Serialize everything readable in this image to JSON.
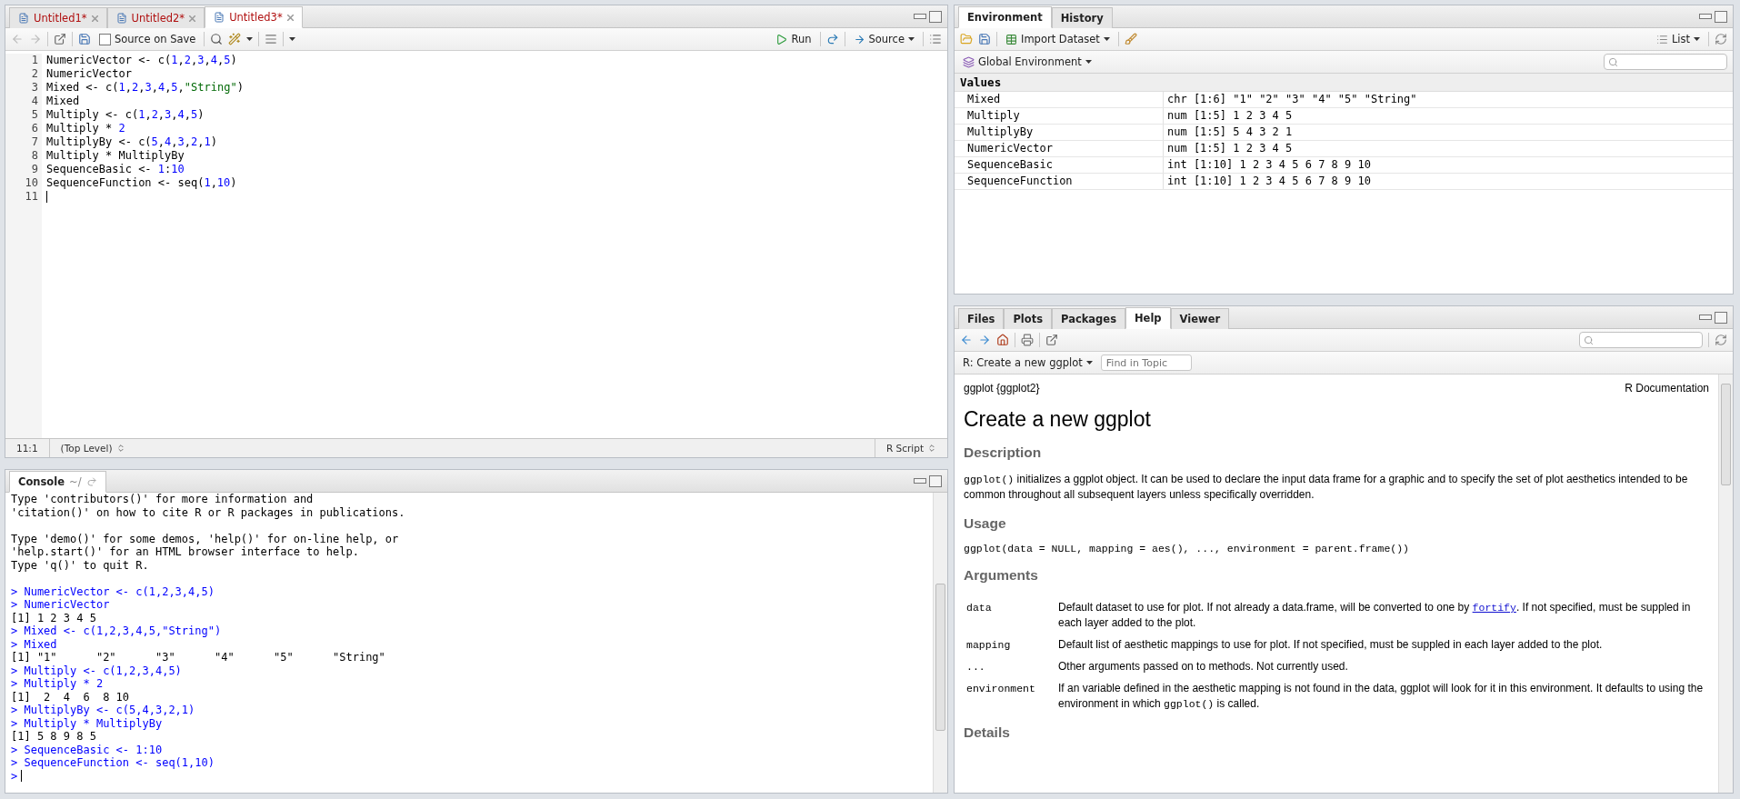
{
  "editor": {
    "tabs": [
      {
        "label": "Untitled1*",
        "selected": false
      },
      {
        "label": "Untitled2*",
        "selected": false
      },
      {
        "label": "Untitled3*",
        "selected": true
      }
    ],
    "toolbar": {
      "source_on_save": {
        "label": "Source on Save",
        "checked": false
      },
      "run": "Run",
      "source": "Source"
    },
    "lines": [
      {
        "n": "1",
        "code": "NumericVector <- c(1,2,3,4,5)"
      },
      {
        "n": "2",
        "code": "NumericVector"
      },
      {
        "n": "3",
        "code": "Mixed <- c(1,2,3,4,5,\"String\")"
      },
      {
        "n": "4",
        "code": "Mixed"
      },
      {
        "n": "5",
        "code": "Multiply <- c(1,2,3,4,5)"
      },
      {
        "n": "6",
        "code": "Multiply * 2"
      },
      {
        "n": "7",
        "code": "MultiplyBy <- c(5,4,3,2,1)"
      },
      {
        "n": "8",
        "code": "Multiply * MultiplyBy"
      },
      {
        "n": "9",
        "code": "SequenceBasic <- 1:10"
      },
      {
        "n": "10",
        "code": "SequenceFunction <- seq(1,10)"
      },
      {
        "n": "11",
        "cursor": true
      }
    ],
    "status": {
      "position": "11:1",
      "scope": "(Top Level)",
      "type": "R Script"
    }
  },
  "console": {
    "title": "Console",
    "path": "~/",
    "lines": [
      {
        "kind": "output",
        "text": "Type 'contributors()' for more information and"
      },
      {
        "kind": "output",
        "text": "'citation()' on how to cite R or R packages in publications."
      },
      {
        "kind": "blank"
      },
      {
        "kind": "output",
        "text": "Type 'demo()' for some demos, 'help()' for on-line help, or"
      },
      {
        "kind": "output",
        "text": "'help.start()' for an HTML browser interface to help."
      },
      {
        "kind": "output",
        "text": "Type 'q()' to quit R."
      },
      {
        "kind": "blank"
      },
      {
        "kind": "input",
        "text": "> NumericVector <- c(1,2,3,4,5)"
      },
      {
        "kind": "input",
        "text": "> NumericVector"
      },
      {
        "kind": "output",
        "text": "[1] 1 2 3 4 5"
      },
      {
        "kind": "input",
        "text": "> Mixed <- c(1,2,3,4,5,\"String\")"
      },
      {
        "kind": "input",
        "text": "> Mixed"
      },
      {
        "kind": "output",
        "text": "[1] \"1\"      \"2\"      \"3\"      \"4\"      \"5\"      \"String\""
      },
      {
        "kind": "input",
        "text": "> Multiply <- c(1,2,3,4,5)"
      },
      {
        "kind": "input",
        "text": "> Multiply * 2"
      },
      {
        "kind": "output",
        "text": "[1]  2  4  6  8 10"
      },
      {
        "kind": "input",
        "text": "> MultiplyBy <- c(5,4,3,2,1)"
      },
      {
        "kind": "input",
        "text": "> Multiply * MultiplyBy"
      },
      {
        "kind": "output",
        "text": "[1] 5 8 9 8 5"
      },
      {
        "kind": "input",
        "text": "> SequenceBasic <- 1:10"
      },
      {
        "kind": "input",
        "text": "> SequenceFunction <- seq(1,10)"
      },
      {
        "kind": "prompt",
        "text": ">"
      }
    ]
  },
  "environment": {
    "tabs": [
      {
        "label": "Environment",
        "selected": true
      },
      {
        "label": "History",
        "selected": false
      }
    ],
    "import": "Import Dataset",
    "view": "List",
    "scope": "Global Environment",
    "section": "Values",
    "rows": [
      {
        "name": "Mixed",
        "value": "chr [1:6] \"1\" \"2\" \"3\" \"4\" \"5\" \"String\""
      },
      {
        "name": "Multiply",
        "value": "num [1:5] 1 2 3 4 5"
      },
      {
        "name": "MultiplyBy",
        "value": "num [1:5] 5 4 3 2 1"
      },
      {
        "name": "NumericVector",
        "value": "num [1:5] 1 2 3 4 5"
      },
      {
        "name": "SequenceBasic",
        "value": "int [1:10] 1 2 3 4 5 6 7 8 9 10"
      },
      {
        "name": "SequenceFunction",
        "value": "int [1:10] 1 2 3 4 5 6 7 8 9 10"
      }
    ]
  },
  "help": {
    "tabs": [
      {
        "label": "Files",
        "selected": false
      },
      {
        "label": "Plots",
        "selected": false
      },
      {
        "label": "Packages",
        "selected": false
      },
      {
        "label": "Help",
        "selected": true
      },
      {
        "label": "Viewer",
        "selected": false
      }
    ],
    "topic": "R: Create a new ggplot",
    "find_placeholder": "Find in Topic",
    "page": {
      "name": "ggplot {ggplot2}",
      "doc": "R Documentation",
      "title": "Create a new ggplot",
      "sections": [
        {
          "kind": "heading",
          "text": "Description"
        },
        {
          "kind": "paragraph",
          "parts": [
            {
              "kind": "code",
              "text": "ggplot()"
            },
            {
              "kind": "text",
              "text": " initializes a ggplot object. It can be used to declare the input data frame for a graphic and to specify the set of plot aesthetics intended to be common throughout all subsequent layers unless specifically overridden."
            }
          ]
        },
        {
          "kind": "heading",
          "text": "Usage"
        },
        {
          "kind": "usage",
          "text": "ggplot(data = NULL, mapping = aes(), ..., environment = parent.frame())"
        },
        {
          "kind": "heading",
          "text": "Arguments"
        },
        {
          "kind": "arguments",
          "items": [
            {
              "name": "data",
              "parts": [
                {
                  "kind": "text",
                  "text": "Default dataset to use for plot. If not already a data.frame, will be converted to one by "
                },
                {
                  "kind": "link",
                  "text": "fortify"
                },
                {
                  "kind": "text",
                  "text": ". If not specified, must be suppled in each layer added to the plot."
                }
              ]
            },
            {
              "name": "mapping",
              "parts": [
                {
                  "kind": "text",
                  "text": "Default list of aesthetic mappings to use for plot. If not specified, must be suppled in each layer added to the plot."
                }
              ]
            },
            {
              "name": "...",
              "parts": [
                {
                  "kind": "text",
                  "text": "Other arguments passed on to methods. Not currently used."
                }
              ]
            },
            {
              "name": "environment",
              "parts": [
                {
                  "kind": "text",
                  "text": "If an variable defined in the aesthetic mapping is not found in the data, ggplot will look for it in this environment. It defaults to using the environment in which "
                },
                {
                  "kind": "code",
                  "text": "ggplot()"
                },
                {
                  "kind": "text",
                  "text": " is called."
                }
              ]
            }
          ]
        },
        {
          "kind": "heading",
          "text": "Details"
        }
      ]
    }
  }
}
